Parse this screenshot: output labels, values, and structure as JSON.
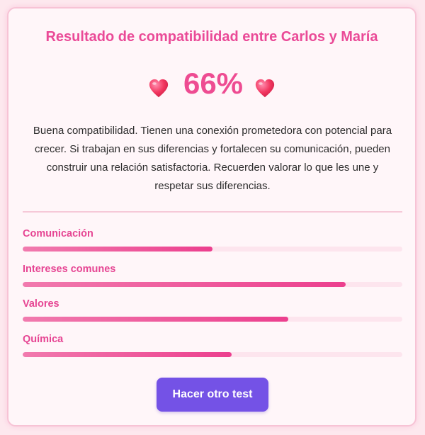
{
  "title": "Resultado de compatibilidad entre Carlos y María",
  "score": {
    "value": "66%",
    "icon": "heart-icon"
  },
  "description": "Buena compatibilidad. Tienen una conexión prometedora con potencial para crecer. Si trabajan en sus diferencias y fortalecen su comunicación, pueden construir una relación satisfactoria. Recuerden valorar lo que les une y respetar sus diferencias.",
  "metrics": [
    {
      "label": "Comunicación",
      "level": 0.5
    },
    {
      "label": "Intereses comunes",
      "level": 0.85
    },
    {
      "label": "Valores",
      "level": 0.7
    },
    {
      "label": "Química",
      "level": 0.55
    }
  ],
  "button": {
    "label": "Hacer otro test"
  },
  "colors": {
    "accent": "#ea4a97",
    "button": "#7452e6",
    "background": "#fde8ee"
  }
}
